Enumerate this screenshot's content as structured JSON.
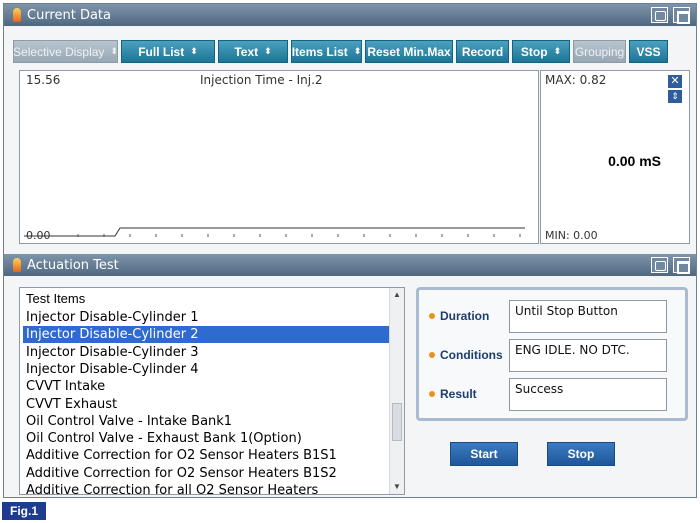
{
  "current_data": {
    "title": "Current Data",
    "toolbar": [
      {
        "label": "Selective Display",
        "arrows": true,
        "enabled": false
      },
      {
        "label": "Full List",
        "arrows": true,
        "enabled": true
      },
      {
        "label": "Text",
        "arrows": true,
        "enabled": true
      },
      {
        "label": "Items List",
        "arrows": true,
        "enabled": true
      },
      {
        "label": "Reset Min.Max",
        "arrows": false,
        "enabled": true
      },
      {
        "label": "Record",
        "arrows": false,
        "enabled": true
      },
      {
        "label": "Stop",
        "arrows": true,
        "enabled": true
      },
      {
        "label": "Grouping",
        "arrows": false,
        "enabled": false
      },
      {
        "label": "VSS",
        "arrows": false,
        "enabled": true
      }
    ],
    "graph": {
      "scale_max": "15.56",
      "scale_min": "0.00",
      "item_title": "Injection Time - Inj.2",
      "max_label": "MAX: 0.82",
      "min_label": "MIN: 0.00",
      "current_value": "0.00 mS"
    }
  },
  "actuation_test": {
    "title": "Actuation Test",
    "list_header": "Test Items",
    "items": [
      "Injector Disable-Cylinder 1",
      "Injector Disable-Cylinder 2",
      "Injector Disable-Cylinder 3",
      "Injector Disable-Cylinder 4",
      "CVVT Intake",
      "CVVT Exhaust",
      "Oil Control Valve - Intake Bank1",
      "Oil Control Valve - Exhaust Bank 1(Option)",
      "Additive Correction for O2 Sensor Heaters B1S1",
      "Additive Correction for O2 Sensor Heaters B1S2",
      "Additive Correction for all O2 Sensor Heaters"
    ],
    "selected_index": 1,
    "details": {
      "duration_label": "Duration",
      "duration_value": "Until Stop Button",
      "conditions_label": "Conditions",
      "conditions_value": "ENG IDLE. NO DTC.",
      "result_label": "Result",
      "result_value": "Success"
    },
    "start_label": "Start",
    "stop_label": "Stop"
  },
  "figure_label": "Fig.1",
  "icons": [
    "flame-icon",
    "retry-icon",
    "window-icon",
    "close-icon",
    "updown-icon"
  ],
  "colors": {
    "titlebar": "#5a7189",
    "button": "#2b86a8",
    "selection": "#2f6ad0",
    "figure_tag": "#1d3c8f"
  }
}
